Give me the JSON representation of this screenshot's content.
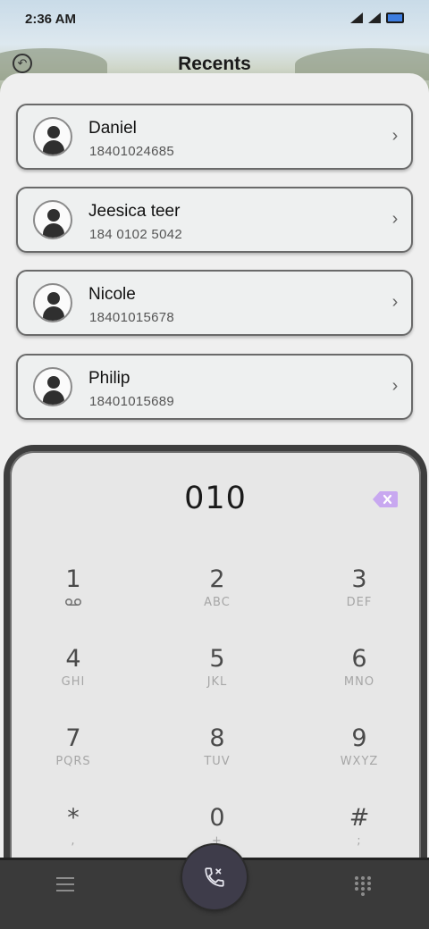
{
  "statusbar": {
    "time": "2:36 AM",
    "icons": [
      "signal-icon",
      "wifi-icon",
      "battery-icon"
    ]
  },
  "header": {
    "title": "Recents",
    "back_icon": "back-icon"
  },
  "contacts": [
    {
      "name": "Daniel",
      "number": "18401024685"
    },
    {
      "name": "Jeesica teer",
      "number": "184 0102 5042"
    },
    {
      "name": "Nicole",
      "number": "18401015678"
    },
    {
      "name": "Philip",
      "number": "18401015689"
    }
  ],
  "dialer": {
    "value": "010",
    "keys": [
      {
        "digit": "1",
        "letters": "",
        "icon": "voicemail-icon"
      },
      {
        "digit": "2",
        "letters": "ABC"
      },
      {
        "digit": "3",
        "letters": "DEF"
      },
      {
        "digit": "4",
        "letters": "GHI"
      },
      {
        "digit": "5",
        "letters": "JKL"
      },
      {
        "digit": "6",
        "letters": "MNO"
      },
      {
        "digit": "7",
        "letters": "PQRS"
      },
      {
        "digit": "8",
        "letters": "TUV"
      },
      {
        "digit": "9",
        "letters": "WXYZ"
      },
      {
        "digit": "*",
        "letters": ","
      },
      {
        "digit": "0",
        "letters": "+"
      },
      {
        "digit": "#",
        "letters": ";"
      }
    ],
    "backspace_color": "#c8a8f0"
  },
  "bottombar": {
    "left_icon": "menu-icon",
    "center_icon": "call-icon",
    "right_icon": "dialpad-icon"
  }
}
